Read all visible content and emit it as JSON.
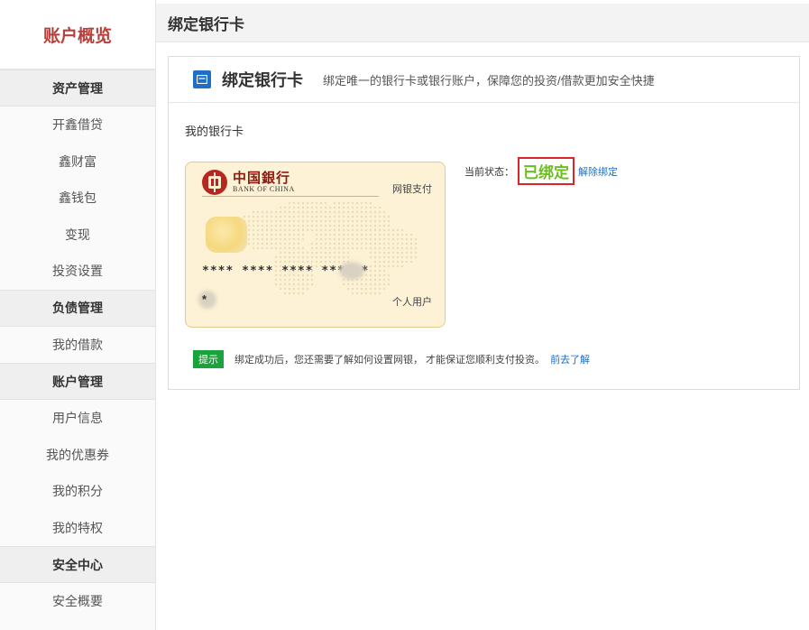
{
  "sidebar": {
    "title": "账户概览",
    "groups": [
      {
        "label": "资产管理",
        "items": [
          "开鑫借贷",
          "鑫财富",
          "鑫钱包",
          "变现",
          "投资设置"
        ]
      },
      {
        "label": "负债管理",
        "items": [
          "我的借款"
        ]
      },
      {
        "label": "账户管理",
        "items": [
          "用户信息",
          "我的优惠券",
          "我的积分",
          "我的特权"
        ]
      },
      {
        "label": "安全中心",
        "items": [
          "安全概要"
        ]
      }
    ]
  },
  "main": {
    "header_title": "绑定银行卡",
    "panel": {
      "icon": "card-icon",
      "title": "绑定银行卡",
      "description": "绑定唯一的银行卡或银行账户，保障您的投资/借款更加安全快捷",
      "section_label": "我的银行卡",
      "card": {
        "bank_name_cn": "中国銀行",
        "bank_name_en": "BANK OF CHINA",
        "pay_type": "网银支付",
        "number_masked": "**** **** **** **** *",
        "holder_masked": "*",
        "user_type": "个人用户"
      },
      "status": {
        "label": "当前状态：",
        "value": "已绑定",
        "unbind_link": "解除绑定"
      },
      "tip": {
        "badge": "提示",
        "text": "绑定成功后，您还需要了解如何设置网银， 才能保证您顺利支付投资。",
        "link": "前去了解"
      }
    }
  },
  "colors": {
    "sidebar_title": "#b5403c",
    "status_value": "#6bbf1a",
    "status_border": "#d8262b",
    "link": "#1e6fc2",
    "tip_badge": "#19a33a",
    "card_bg": "#fdf2d5",
    "bank_red": "#b5271f"
  }
}
